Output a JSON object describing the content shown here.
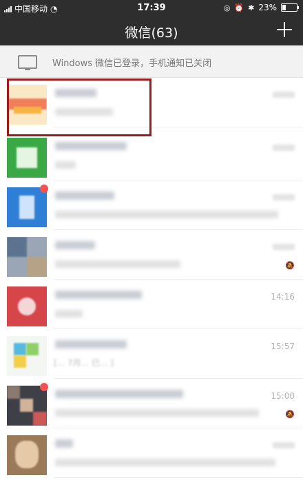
{
  "status_bar": {
    "carrier": "中国移动",
    "time": "17:39",
    "battery": "23%",
    "battery_level": 0.23
  },
  "nav": {
    "title": "微信(63)"
  },
  "notice": {
    "text": "Windows 微信已登录，手机通知已关闭"
  },
  "chats": [
    {
      "time": ""
    },
    {
      "time": ""
    },
    {
      "time": ""
    },
    {
      "time": ""
    },
    {
      "time": "14:16"
    },
    {
      "time": "15:57",
      "message": "[... 7月... 已... ]"
    },
    {
      "time": "15:00"
    },
    {
      "time": ""
    }
  ]
}
